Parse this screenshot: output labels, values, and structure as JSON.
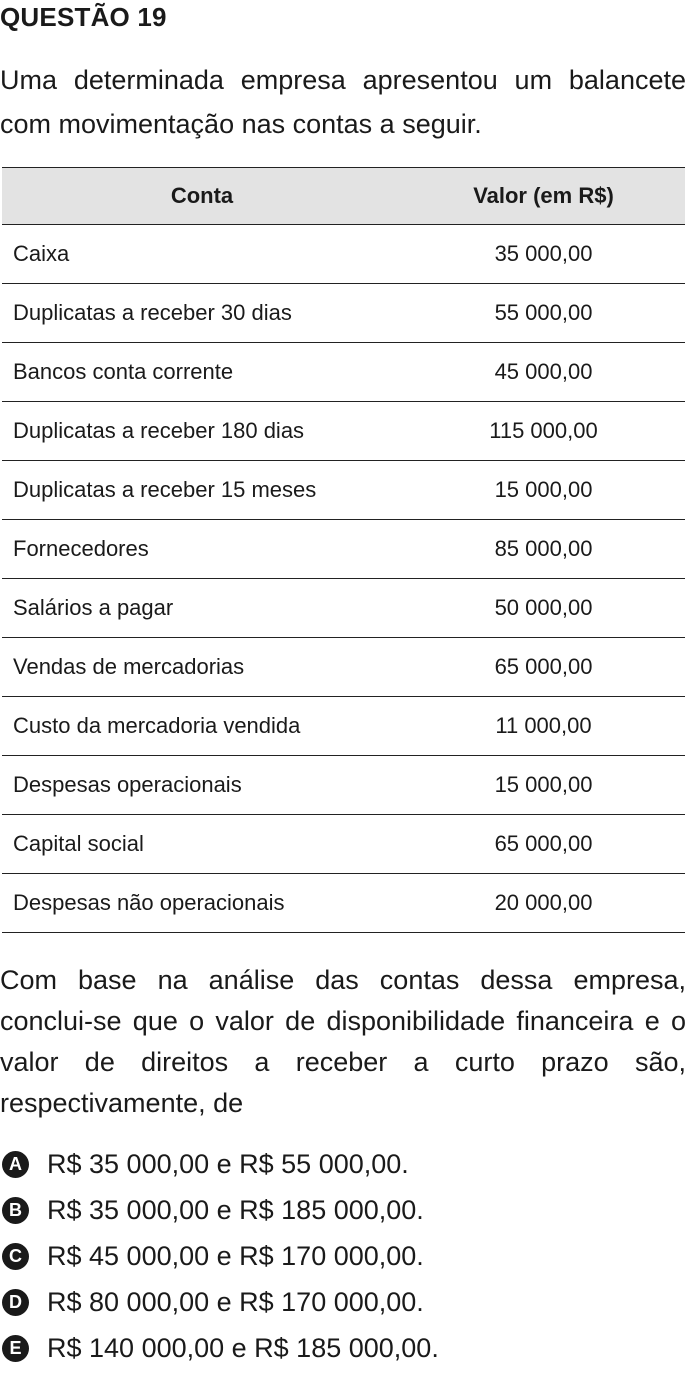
{
  "question": {
    "title": "QUESTÃO 19",
    "intro": "Uma determinada empresa apresentou um balancete com movimentação nas contas a seguir.",
    "table": {
      "header_account": "Conta",
      "header_value": "Valor (em R$)",
      "rows": [
        {
          "account": "Caixa",
          "value": "35 000,00"
        },
        {
          "account": "Duplicatas a receber 30 dias",
          "value": "55 000,00"
        },
        {
          "account": "Bancos conta corrente",
          "value": "45 000,00"
        },
        {
          "account": "Duplicatas a receber 180 dias",
          "value": "115 000,00"
        },
        {
          "account": "Duplicatas a receber 15 meses",
          "value": "15 000,00"
        },
        {
          "account": "Fornecedores",
          "value": "85 000,00"
        },
        {
          "account": "Salários a pagar",
          "value": "50 000,00"
        },
        {
          "account": "Vendas de mercadorias",
          "value": "65 000,00"
        },
        {
          "account": "Custo da mercadoria vendida",
          "value": "11 000,00"
        },
        {
          "account": "Despesas operacionais",
          "value": "15 000,00"
        },
        {
          "account": "Capital social",
          "value": "65 000,00"
        },
        {
          "account": "Despesas não operacionais",
          "value": "20 000,00"
        }
      ]
    },
    "prompt": "Com base na análise das contas dessa empresa, conclui-se que o valor de disponibilidade financeira e o valor de direitos a receber a curto prazo são, respectivamente, de",
    "options": [
      {
        "letter": "A",
        "text": "R$ 35 000,00 e R$ 55 000,00."
      },
      {
        "letter": "B",
        "text": "R$ 35 000,00 e R$ 185 000,00."
      },
      {
        "letter": "C",
        "text": "R$ 45 000,00 e R$ 170 000,00."
      },
      {
        "letter": "D",
        "text": "R$ 80 000,00 e R$ 170 000,00."
      },
      {
        "letter": "E",
        "text": "R$ 140 000,00 e R$ 185 000,00."
      }
    ]
  }
}
